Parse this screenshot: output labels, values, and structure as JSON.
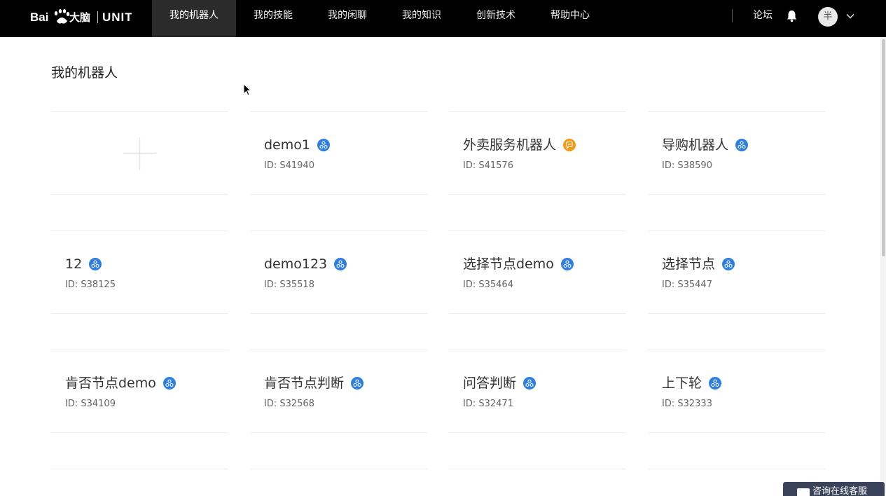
{
  "brand": {
    "logo_text": "Bai都大脑 | UNIT"
  },
  "nav": {
    "items": [
      {
        "label": "我的机器人",
        "active": true
      },
      {
        "label": "我的技能",
        "active": false
      },
      {
        "label": "我的闲聊",
        "active": false
      },
      {
        "label": "我的知识",
        "active": false
      },
      {
        "label": "创新技术",
        "active": false
      },
      {
        "label": "帮助中心",
        "active": false
      }
    ],
    "forum": "论坛",
    "avatar_text": "半"
  },
  "page": {
    "title": "我的机器人"
  },
  "colors": {
    "accent_blue": "#2f7fe0",
    "accent_orange": "#f29b18",
    "topbar": "#000000"
  },
  "robots": [
    {
      "name": "demo1",
      "id": "ID:  S41940",
      "icon": "skill-network-icon",
      "icon_color": "#2f7fe0"
    },
    {
      "name": "外卖服务机器人",
      "id": "ID:  S41576",
      "icon": "skill-chat-icon",
      "icon_color": "#f29b18"
    },
    {
      "name": "导购机器人",
      "id": "ID:  S38590",
      "icon": "skill-network-icon",
      "icon_color": "#2f7fe0"
    },
    {
      "name": "12",
      "id": "ID:  S38125",
      "icon": "skill-network-icon",
      "icon_color": "#2f7fe0"
    },
    {
      "name": "demo123",
      "id": "ID:  S35518",
      "icon": "skill-network-icon",
      "icon_color": "#2f7fe0"
    },
    {
      "name": "选择节点demo",
      "id": "ID:  S35464",
      "icon": "skill-network-icon",
      "icon_color": "#2f7fe0"
    },
    {
      "name": "选择节点",
      "id": "ID:  S35447",
      "icon": "skill-network-icon",
      "icon_color": "#2f7fe0"
    },
    {
      "name": "肯否节点demo",
      "id": "ID:  S34109",
      "icon": "skill-network-icon",
      "icon_color": "#2f7fe0"
    },
    {
      "name": "肯否节点判断",
      "id": "ID:  S32568",
      "icon": "skill-network-icon",
      "icon_color": "#2f7fe0"
    },
    {
      "name": "问答判断",
      "id": "ID:  S32471",
      "icon": "skill-network-icon",
      "icon_color": "#2f7fe0"
    },
    {
      "name": "上下轮",
      "id": "ID:  S32333",
      "icon": "skill-network-icon",
      "icon_color": "#2f7fe0"
    }
  ],
  "help_button": {
    "label": "咨询在线客服"
  }
}
